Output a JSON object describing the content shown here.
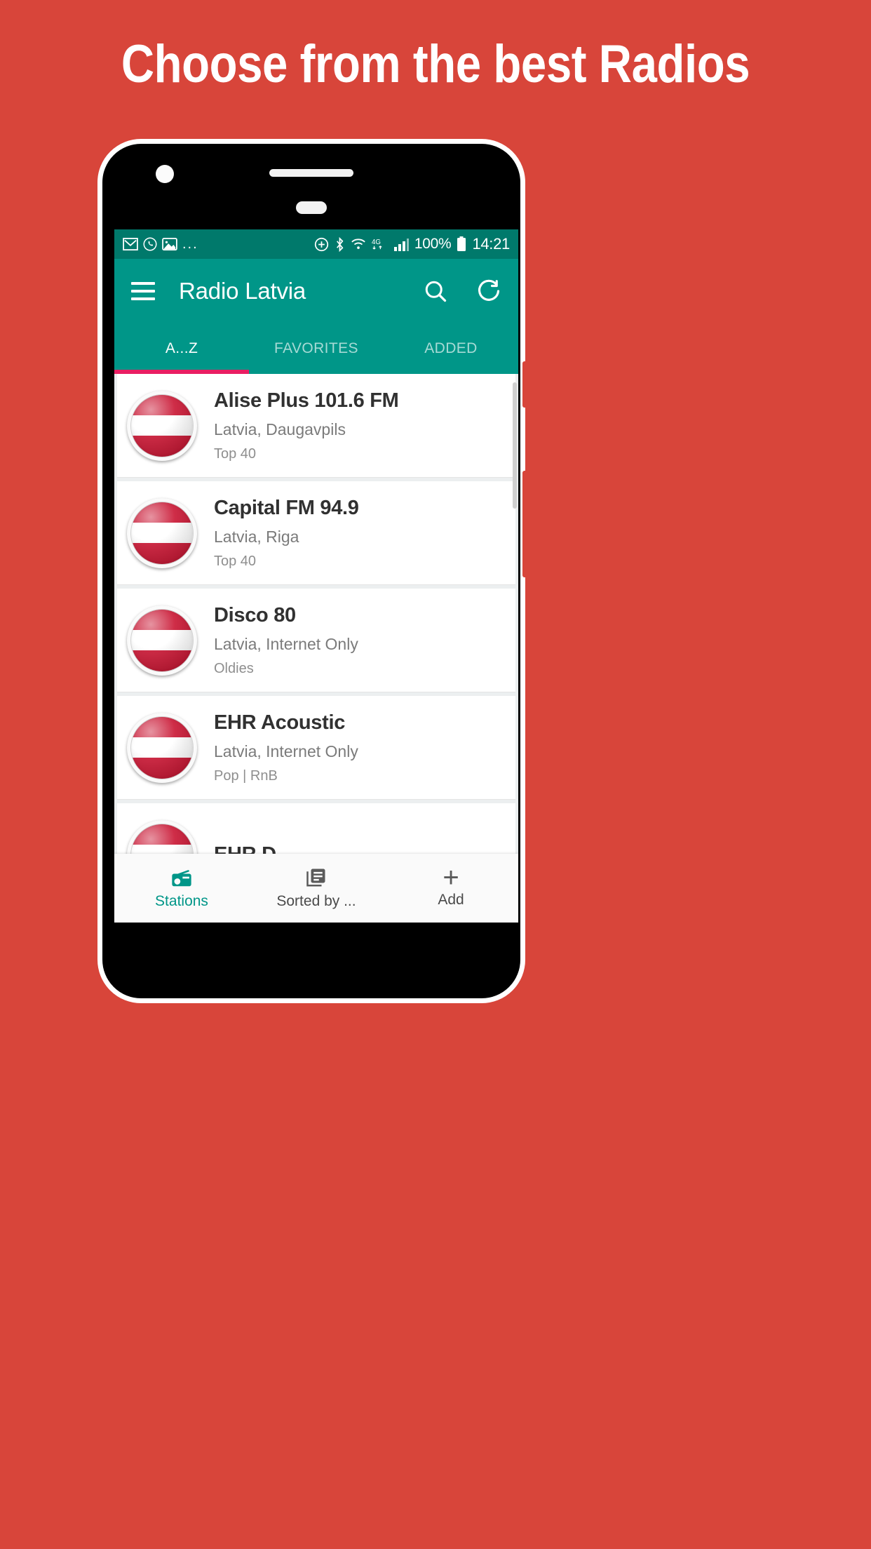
{
  "poster": {
    "headline": "Choose from the best Radios",
    "background_color": "#d8453a",
    "accent_color": "#009688",
    "tab_indicator_color": "#e91e63"
  },
  "statusbar": {
    "notification_icons": [
      "gmail-icon",
      "whatsapp-icon",
      "photo-icon"
    ],
    "overflow": "...",
    "icons_right": [
      "location-add-icon",
      "bluetooth-icon",
      "wifi-icon",
      "4g-icon",
      "signal-icon"
    ],
    "network_label": "4G",
    "battery_percent": "100%",
    "time": "14:21"
  },
  "appbar": {
    "menu_icon": "hamburger-menu-icon",
    "title": "Radio Latvia",
    "search_icon": "search-icon",
    "refresh_icon": "refresh-icon"
  },
  "tabs": {
    "items": [
      {
        "label": "A...Z",
        "active": true
      },
      {
        "label": "FAVORITES",
        "active": false
      },
      {
        "label": "ADDED",
        "active": false
      }
    ]
  },
  "stations": [
    {
      "name": "Alise Plus 101.6 FM",
      "location": "Latvia, Daugavpils",
      "genre": "Top 40",
      "flag": "latvia-flag-icon"
    },
    {
      "name": "Capital FM 94.9",
      "location": "Latvia, Riga",
      "genre": "Top 40",
      "flag": "latvia-flag-icon"
    },
    {
      "name": "Disco 80",
      "location": "Latvia, Internet Only",
      "genre": "Oldies",
      "flag": "latvia-flag-icon"
    },
    {
      "name": "EHR Acoustic",
      "location": "Latvia, Internet Only",
      "genre": "Pop | RnB",
      "flag": "latvia-flag-icon"
    },
    {
      "name": "EHR D",
      "location": "",
      "genre": "",
      "flag": "latvia-flag-icon"
    }
  ],
  "bottomnav": {
    "items": [
      {
        "label": "Stations",
        "icon": "radio-icon",
        "active": true
      },
      {
        "label": "Sorted by ...",
        "icon": "library-books-icon",
        "active": false
      },
      {
        "label": "Add",
        "icon": "plus-icon",
        "active": false
      }
    ]
  }
}
